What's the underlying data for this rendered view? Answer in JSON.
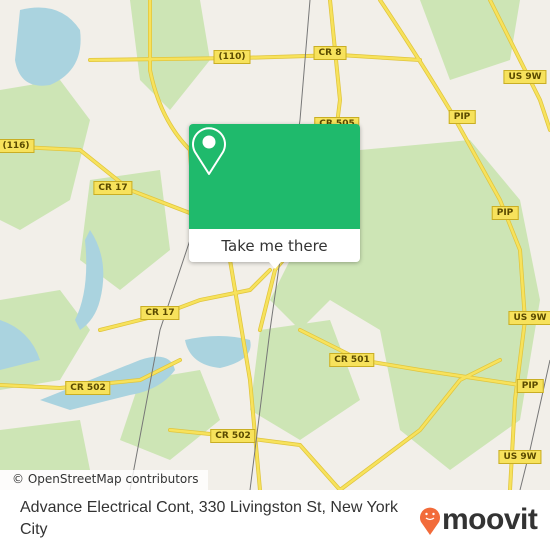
{
  "map": {
    "road_labels": [
      "(110)",
      "CR 8",
      "US 9W",
      "PIP",
      "CR 505",
      "(116)",
      "CR 17",
      "PIP",
      "CR 17",
      "US 9W",
      "CR 501",
      "PIP",
      "CR 502",
      "CR 502",
      "US 9W"
    ],
    "colors": {
      "land": "#f2efe9",
      "park": "#cde5b5",
      "water": "#aad3df",
      "road": "#f7e25c"
    },
    "attribution": "© OpenStreetMap contributors"
  },
  "popup": {
    "icon": "map-pin-icon",
    "color": "#1fba6c",
    "button_label": "Take me there"
  },
  "footer": {
    "address": "Advance Electrical Cont, 330 Livingston St, New York City",
    "logo_text": "moovit",
    "logo_color": "#f26b3a"
  }
}
